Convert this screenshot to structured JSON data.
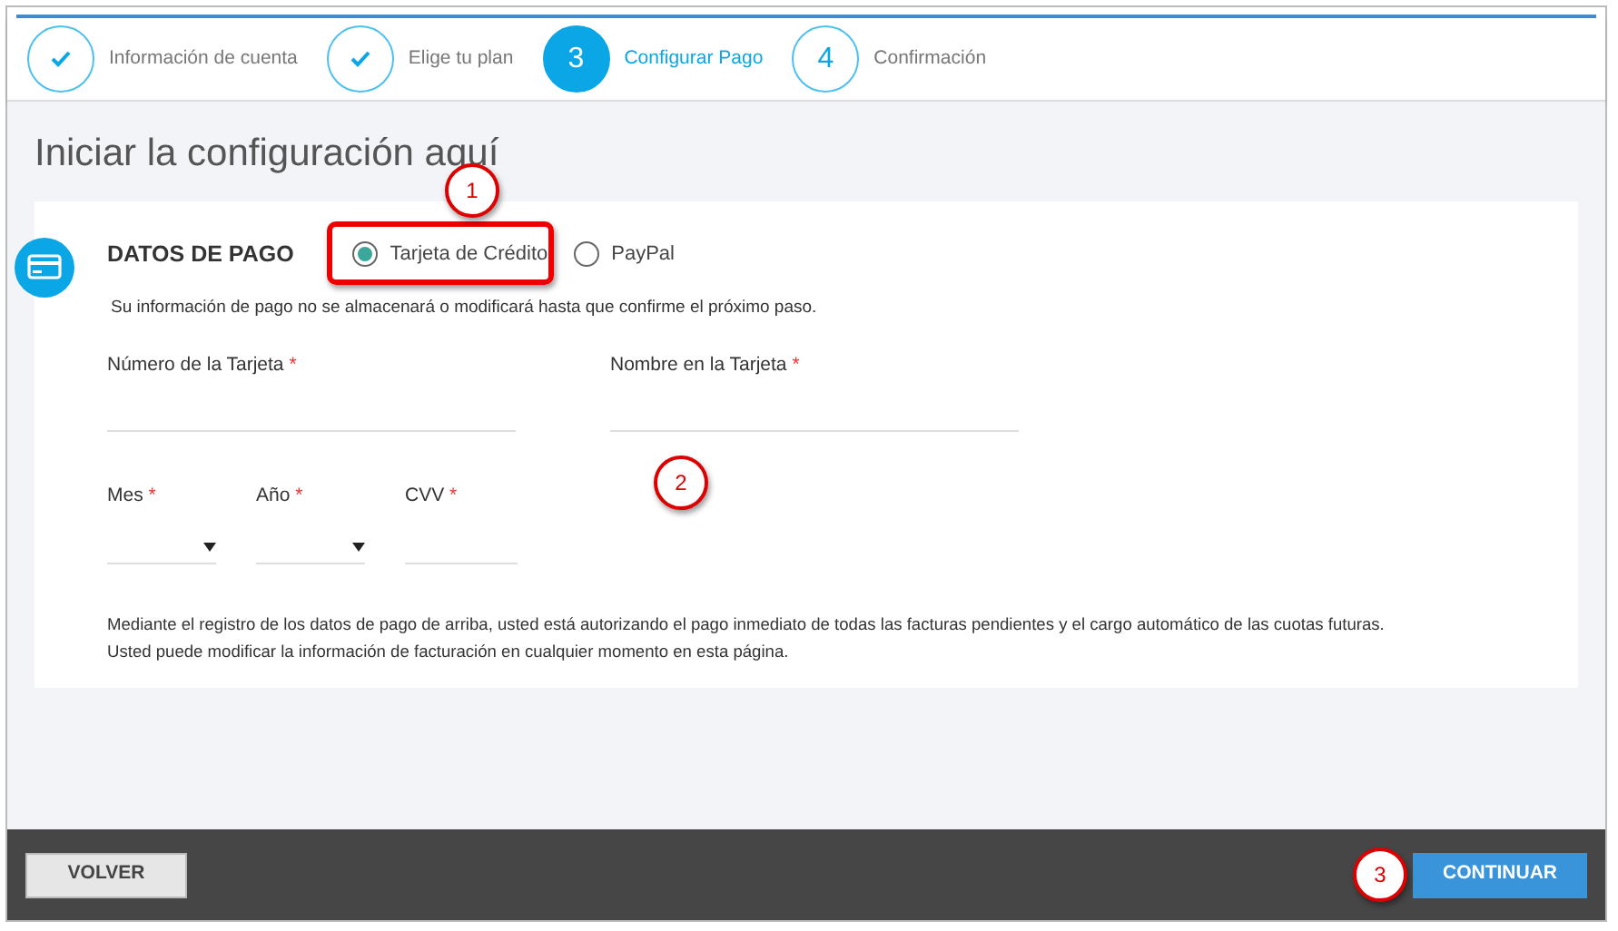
{
  "steps": [
    {
      "kind": "done",
      "label": "Información de cuenta"
    },
    {
      "kind": "done",
      "label": "Elige tu plan"
    },
    {
      "kind": "current",
      "number": "3",
      "label": "Configurar Pago"
    },
    {
      "kind": "pending",
      "number": "4",
      "label": "Confirmación"
    }
  ],
  "title": "Iniciar la configuración aquí",
  "payment": {
    "heading": "DATOS DE PAGO",
    "options": [
      {
        "label": "Tarjeta de Crédito",
        "selected": true
      },
      {
        "label": "PayPal",
        "selected": false
      }
    ],
    "notice": "Su información de pago no se almacenará o modificará hasta que confirme el próximo paso.",
    "fields": [
      {
        "kind": "text",
        "label": "Número de la Tarjeta",
        "required": "*"
      },
      {
        "kind": "text",
        "label": "Nombre en la Tarjeta",
        "required": "*"
      },
      {
        "kind": "select",
        "label": "Mes",
        "required": "*"
      },
      {
        "kind": "select",
        "label": "Año",
        "required": "*"
      },
      {
        "kind": "text",
        "label": "CVV",
        "required": "*"
      }
    ],
    "disclaimer": [
      "Mediante el registro de los datos de pago de arriba, usted está autorizando el pago inmediato de todas las facturas pendientes y el cargo automático de las cuotas futuras.",
      "Usted puede modificar la información de facturación en cualquier momento en esta página."
    ]
  },
  "footer": {
    "back": "VOLVER",
    "next": "CONTINUAR"
  },
  "callouts": [
    {
      "label": "1"
    },
    {
      "label": "2"
    },
    {
      "label": "3"
    }
  ]
}
